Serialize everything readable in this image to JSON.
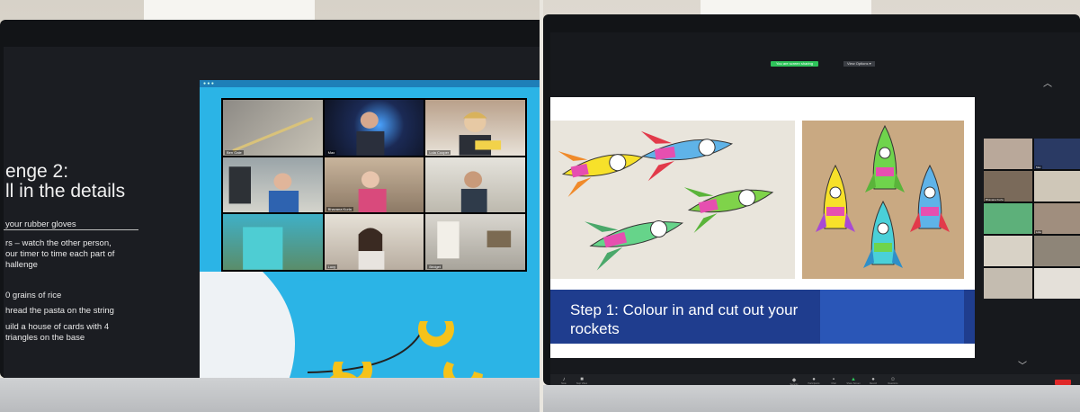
{
  "left": {
    "slide": {
      "title_lines": [
        "enge 2:",
        "ll in the details"
      ],
      "lines": [
        " your rubber gloves",
        "rs – watch the other person,",
        "our timer to time each part of",
        "hallenge",
        "0 grains of rice",
        "hread the pasta on the string",
        "uild a house of cards with 4",
        "triangles on the base"
      ]
    },
    "zoom": {
      "participants": [
        "Ben Gale",
        "Max",
        "Lola Cooper",
        "",
        "Bhavana Kurla",
        "",
        "",
        "Lucy",
        "Bridget"
      ]
    }
  },
  "right": {
    "zoom": {
      "share_indicator": "You are screen sharing",
      "view_label": "View Options ▾",
      "slide_caption": "Step 1: Colour in and cut out your rockets",
      "gallery_names": [
        "",
        "Max",
        "Bhavana Kurla",
        "",
        "",
        "Lola",
        "",
        "",
        "",
        ""
      ],
      "toolbar": [
        "Mute",
        "Stop Video",
        "Security",
        "Participants",
        "Chat",
        "Share Screen",
        "Record",
        "Reactions"
      ]
    }
  },
  "colors": {
    "zoom_blue": "#2bb4e6",
    "caption_band": "#1f3d8e",
    "share_green": "#2ec35a",
    "end_red": "#e02828"
  },
  "icons": [
    "apple-logo-icon",
    "chevron-up-icon",
    "chevron-down-icon",
    "microphone-icon",
    "video-camera-icon",
    "shield-icon",
    "people-icon",
    "chat-bubble-icon",
    "share-screen-icon",
    "record-icon",
    "smiley-icon"
  ]
}
